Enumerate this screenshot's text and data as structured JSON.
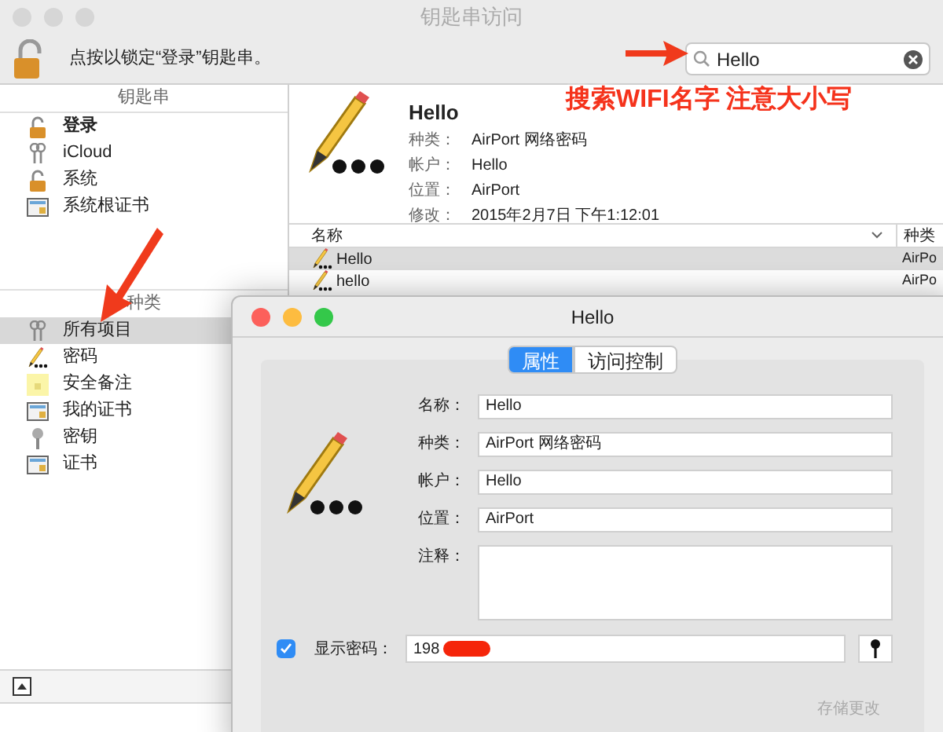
{
  "window": {
    "title": "钥匙串访问"
  },
  "toolbar": {
    "lock_text": "点按以锁定“登录”钥匙串。",
    "search": {
      "value": "Hello"
    }
  },
  "sidebar": {
    "keychains_header": "钥匙串",
    "keychains": [
      {
        "label": "登录",
        "kind": "lock",
        "is_default": true
      },
      {
        "label": "iCloud",
        "kind": "keys",
        "is_default": false
      },
      {
        "label": "系统",
        "kind": "lock",
        "is_default": false
      },
      {
        "label": "系统根证书",
        "kind": "cert",
        "is_default": false
      }
    ],
    "categories_header": "种类",
    "categories": [
      {
        "label": "所有项目",
        "kind": "keys",
        "selected": true
      },
      {
        "label": "密码",
        "kind": "pencil",
        "selected": false
      },
      {
        "label": "安全备注",
        "kind": "note",
        "selected": false
      },
      {
        "label": "我的证书",
        "kind": "cert",
        "selected": false
      },
      {
        "label": "密钥",
        "kind": "key",
        "selected": false
      },
      {
        "label": "证书",
        "kind": "cert",
        "selected": false
      }
    ]
  },
  "detail": {
    "name": "Hello",
    "fields": [
      {
        "label": "种类：",
        "value": "AirPort 网络密码"
      },
      {
        "label": "帐户：",
        "value": "Hello"
      },
      {
        "label": "位置：",
        "value": "AirPort"
      },
      {
        "label": "修改：",
        "value": "2015年2月7日 下午1:12:01"
      }
    ]
  },
  "table": {
    "columns": [
      "名称",
      "种类"
    ],
    "rows": [
      {
        "cells": [
          "Hello",
          "AirPo"
        ],
        "selected": true
      },
      {
        "cells": [
          "hello",
          "AirPo"
        ],
        "selected": false
      }
    ]
  },
  "dialog": {
    "title": "Hello",
    "tabs": [
      {
        "label": "属性",
        "selected": true
      },
      {
        "label": "访问控制",
        "selected": false
      }
    ],
    "fields": [
      {
        "label": "名称：",
        "value": "Hello",
        "kind": "line"
      },
      {
        "label": "种类：",
        "value": "AirPort 网络密码",
        "kind": "line"
      },
      {
        "label": "帐户：",
        "value": "Hello",
        "kind": "line"
      },
      {
        "label": "位置：",
        "value": "AirPort",
        "kind": "line"
      },
      {
        "label": "注释：",
        "kind": "area"
      }
    ],
    "show_password": {
      "label": "显示密码：",
      "checked": true,
      "value": "198"
    },
    "save_button": {
      "label": "存储更改",
      "disabled": true
    }
  },
  "annotations": [
    {
      "text": "搜索WIFI名字 注意大小写"
    }
  ]
}
